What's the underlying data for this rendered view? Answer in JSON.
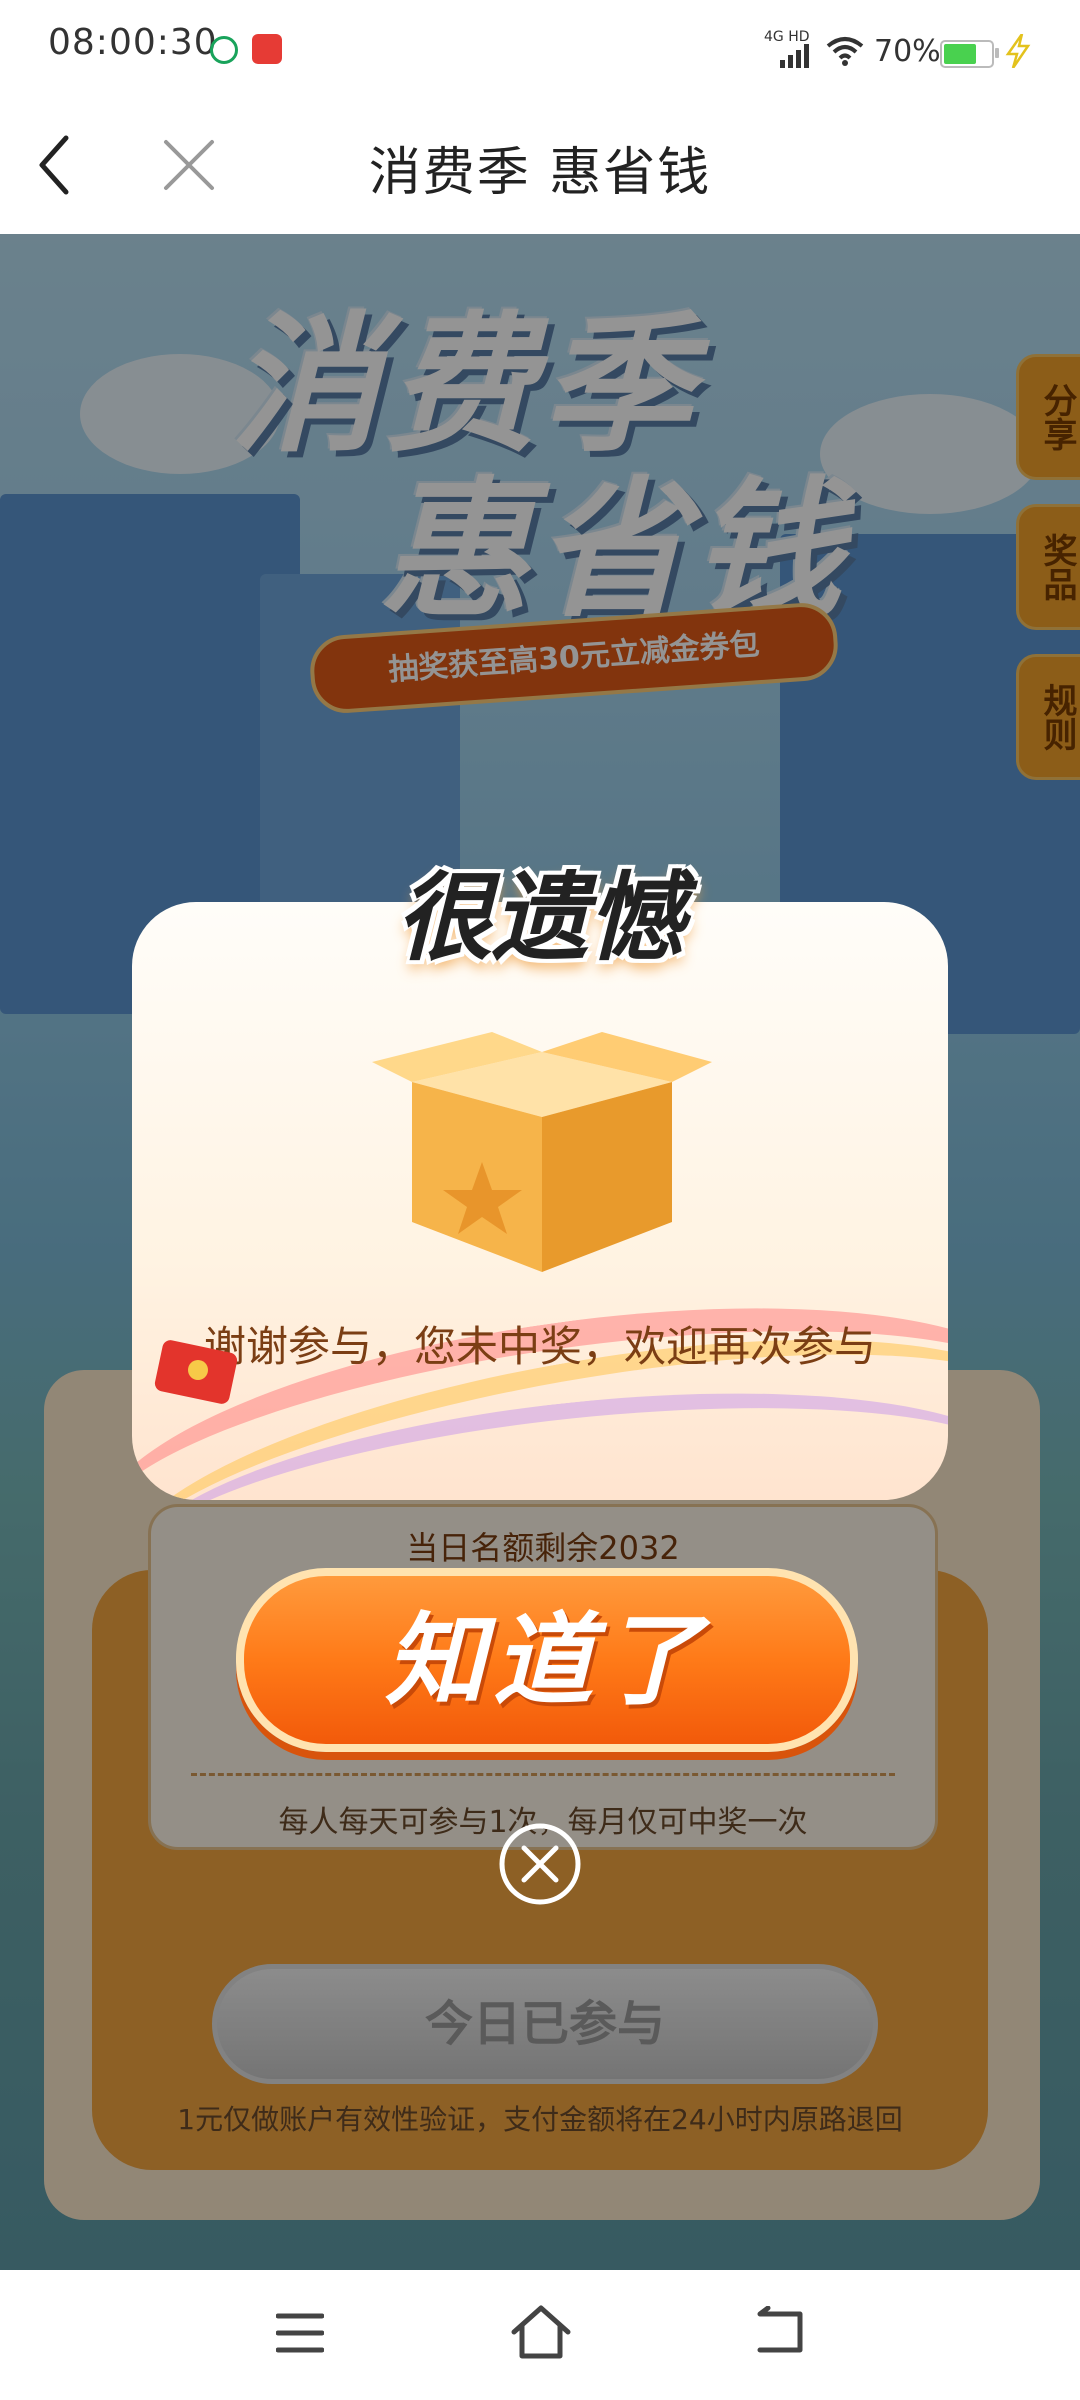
{
  "status_bar": {
    "time": "08:00:30",
    "network": "4G HD",
    "battery_percent": "70%",
    "battery_level": 0.7,
    "icons": [
      "app-notification-icon",
      "app-notification-icon-2",
      "signal-icon",
      "wifi-icon",
      "battery-icon",
      "charging-icon"
    ]
  },
  "navbar": {
    "title": "消费季 惠省钱",
    "back_icon": "back-icon",
    "close_icon": "close-icon"
  },
  "hero": {
    "line1": "消费季",
    "line2": "惠省钱",
    "promo": "抽奖获至高30元立减金券包"
  },
  "side_tabs": [
    "分享",
    "奖品",
    "规则"
  ],
  "card": {
    "remaining": "当日名额剩余2032",
    "rule": "每人每天可参与1次，每月仅可中奖一次",
    "joined_button": "今日已参与",
    "refund_note": "1元仅做账户有效性验证，支付金额将在24小时内原路退回"
  },
  "dialog": {
    "title": "很遗憾",
    "message": "谢谢参与，您未中奖，欢迎再次参与",
    "ok_button": "知道了",
    "close_icon": "circle-close-icon"
  },
  "colors": {
    "accent_orange": "#ff7a18",
    "dialog_text": "#7b3e14",
    "tab_gold": "#f1a02a"
  }
}
